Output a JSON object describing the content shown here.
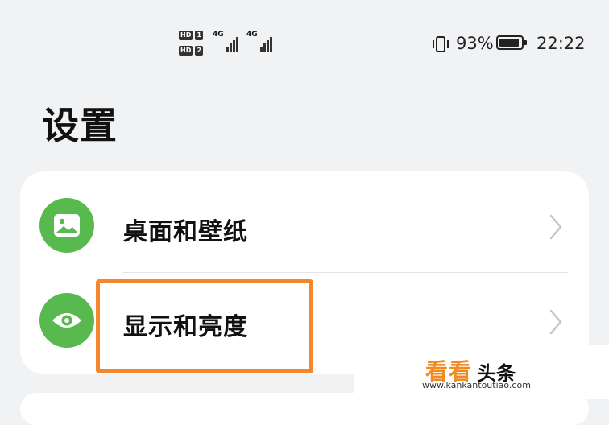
{
  "status_bar": {
    "sim1": "HD",
    "sim1_num": "1",
    "sim2": "HD",
    "sim2_num": "2",
    "net1": "4G",
    "net2": "4G",
    "battery_percent": "93%",
    "battery_level": 0.93,
    "time": "22:22"
  },
  "page": {
    "title": "设置"
  },
  "settings": {
    "items": [
      {
        "label": "桌面和壁纸",
        "icon": "wallpaper-image-icon",
        "icon_color": "#58b94f"
      },
      {
        "label": "显示和亮度",
        "icon": "eye-icon",
        "icon_color": "#58b94f"
      }
    ]
  },
  "highlight_color": "#f4862d",
  "watermark": {
    "brand": "看看",
    "brand_suffix": "头条",
    "url": "www.kankantoutiao.com"
  }
}
